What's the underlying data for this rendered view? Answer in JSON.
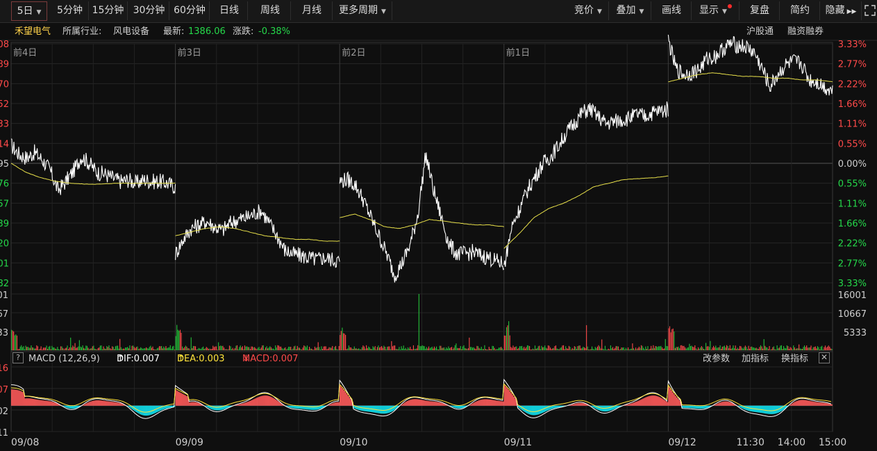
{
  "toolbar": {
    "left": [
      {
        "label": "5日",
        "caret": true,
        "active": true
      },
      {
        "label": "5分钟"
      },
      {
        "label": "15分钟"
      },
      {
        "label": "30分钟"
      },
      {
        "label": "60分钟"
      },
      {
        "label": "日线"
      },
      {
        "label": "周线"
      },
      {
        "label": "月线"
      },
      {
        "label": "更多周期",
        "caret": true
      }
    ],
    "right": [
      {
        "label": "竞价",
        "caret": true
      },
      {
        "label": "叠加",
        "caret": true
      },
      {
        "label": "画线"
      },
      {
        "label": "显示",
        "caret": true,
        "dot": true
      },
      {
        "label": "复盘"
      },
      {
        "label": "简约"
      },
      {
        "label": "隐藏",
        "arrows": "▶▶"
      }
    ],
    "fullscreen_icon": "fullscreen-icon"
  },
  "info": {
    "stock_name": "禾望电气",
    "industry_label": "所属行业:",
    "industry": "风电设备",
    "latest_label": "最新:",
    "latest": "1386.06",
    "change_label": "涨跌:",
    "change": "-0.38%",
    "links": [
      "沪股通",
      "融资融券"
    ]
  },
  "chart_data": {
    "type": "line",
    "day_markers": [
      "前4日",
      "前3日",
      "前2日",
      "前1日"
    ],
    "right_axis_labels": [
      "3.33%",
      "2.77%",
      "2.22%",
      "1.66%",
      "1.11%",
      "0.55%",
      "0.00%",
      "0.55%",
      "1.11%",
      "1.66%",
      "2.22%",
      "2.77%",
      "3.33%"
    ],
    "right_axis_range_pct": [
      -3.33,
      3.33
    ],
    "left_axis_labels_partial": [
      "08",
      "89",
      "70",
      "52",
      "33",
      "14",
      "95",
      "76",
      "57",
      "39",
      "20",
      "01",
      "82"
    ],
    "x_labels": [
      "09/08",
      "09/09",
      "09/10",
      "09/11",
      "09/12",
      "11:30",
      "14:00",
      "15:00"
    ],
    "series": [
      {
        "kind": "price_pct",
        "color": "#ffffff",
        "days": [
          [
            1.0,
            0.5,
            0.3,
            0.6,
            0.2,
            -0.4,
            -1.5,
            -1.0,
            -0.4,
            0.4,
            0.0,
            -0.5,
            -0.6,
            -0.8,
            -1.0,
            -0.9,
            -1.1,
            -0.9,
            -1.0,
            -1.0,
            -1.1,
            -1.3
          ],
          [
            -5.0,
            -4.2,
            -3.6,
            -3.4,
            -3.2,
            -3.5,
            -3.7,
            -3.3,
            -3.1,
            -3.0,
            -2.8,
            -2.6,
            -3.3,
            -4.0,
            -4.8,
            -5.0,
            -5.1,
            -5.2,
            -5.3,
            -5.2,
            -5.3,
            -5.4
          ],
          [
            -1.0,
            -0.9,
            -1.2,
            -2.0,
            -3.0,
            -4.0,
            -5.0,
            -6.2,
            -5.5,
            -4.5,
            -2.8,
            0.5,
            -1.5,
            -3.0,
            -4.5,
            -5.0,
            -5.0,
            -4.9,
            -5.1,
            -5.2,
            -5.4,
            -5.6
          ],
          [
            -5.7,
            -3.5,
            -2.5,
            -1.5,
            -0.7,
            0.0,
            0.4,
            1.0,
            1.7,
            2.2,
            2.8,
            3.0,
            2.6,
            2.2,
            2.3,
            2.4,
            2.5,
            2.7,
            2.6,
            2.8,
            2.9,
            3.0
          ],
          [
            6.8,
            5.2,
            4.9,
            5.0,
            5.2,
            5.8,
            5.9,
            6.3,
            6.6,
            6.5,
            6.4,
            6.1,
            5.2,
            4.2,
            4.9,
            5.4,
            5.6,
            5.5,
            4.6,
            4.5,
            4.2,
            4.0
          ]
        ]
      },
      {
        "kind": "avg_pct",
        "color": "#e8e04a",
        "days": [
          [
            0.0,
            -0.5,
            -0.8,
            -1.0,
            -1.1,
            -1.15,
            -1.15,
            -1.1,
            -1.1,
            -1.1,
            -1.1,
            -1.1
          ],
          [
            -4.0,
            -3.8,
            -3.6,
            -3.5,
            -3.6,
            -3.8,
            -4.0,
            -4.1,
            -4.2,
            -4.2,
            -4.3,
            -4.3
          ],
          [
            -3.0,
            -2.8,
            -3.1,
            -3.5,
            -3.6,
            -3.4,
            -3.1,
            -3.2,
            -3.3,
            -3.4,
            -3.4,
            -3.5
          ],
          [
            -4.7,
            -3.9,
            -3.0,
            -2.5,
            -2.2,
            -1.8,
            -1.3,
            -1.1,
            -0.9,
            -0.85,
            -0.8,
            -0.7
          ],
          [
            4.5,
            4.7,
            4.9,
            5.0,
            4.9,
            4.8,
            4.8,
            4.7,
            4.7,
            4.6,
            4.6,
            4.5
          ]
        ]
      }
    ],
    "volume": {
      "axis_labels": [
        "16001",
        "10667",
        "5333"
      ],
      "max": 16001,
      "spike_day_index": 2,
      "spike_value": 16001,
      "spike2_day_index": 3,
      "spike2_value": 11500
    },
    "macd": {
      "label": "MACD (12,26,9)",
      "dif_label": "DIF:0.007",
      "dea_label": "DEA:0.003",
      "macd_label": "MACD:0.007",
      "dif_arrow": "↑",
      "dea_arrow": "↑",
      "macd_arrow": "↓",
      "left_labels": [
        "16",
        "07",
        "02",
        "11"
      ],
      "actions": [
        "改参数",
        "加指标",
        "换指标"
      ]
    }
  }
}
